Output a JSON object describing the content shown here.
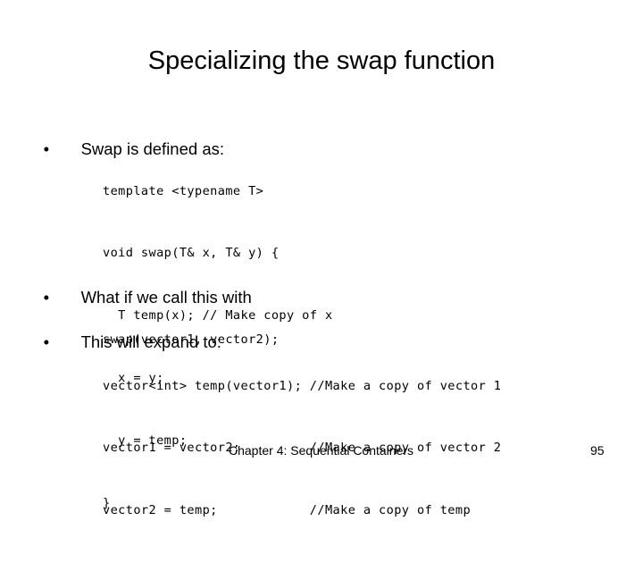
{
  "slide": {
    "title": "Specializing the swap function",
    "bullets": [
      {
        "text": "Swap is defined as:",
        "code": [
          "template <typename T>",
          "void swap(T& x, T& y) {",
          "  T temp(x); // Make copy of x",
          "  x = y;",
          "  y = temp;",
          "}"
        ]
      },
      {
        "text": "What if we call this with",
        "code": [
          "swap(vector1, vector2);"
        ]
      },
      {
        "text": "This will expand to:",
        "code": [
          "vector<int> temp(vector1); //Make a copy of vector 1",
          "vector1 = vector2;         //Make a copy of vector 2",
          "vector2 = temp;            //Make a copy of temp"
        ]
      }
    ],
    "bullet_glyph": "•"
  },
  "footer": {
    "chapter": "Chapter 4: Sequential Containers",
    "page_number": "95"
  }
}
